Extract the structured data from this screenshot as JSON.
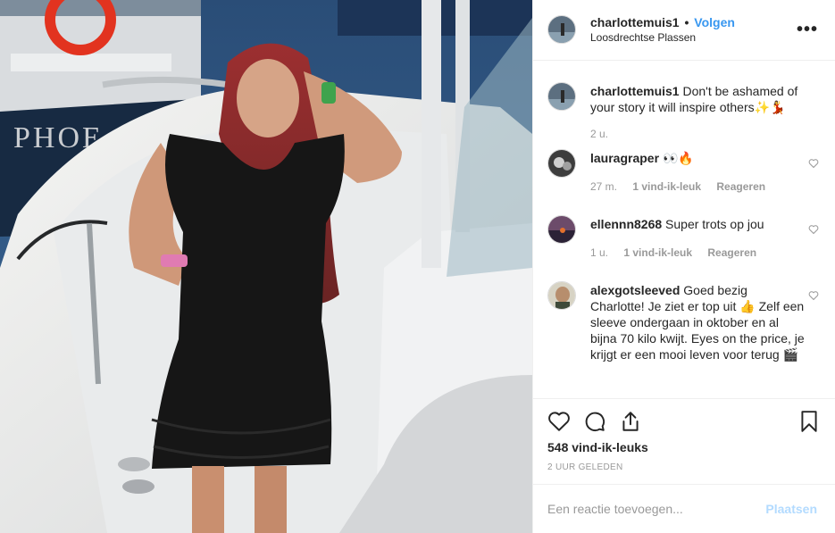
{
  "post": {
    "username": "charlottemuis1",
    "separator": "•",
    "follow_label": "Volgen",
    "location": "Loosdrechtse Plassen",
    "more_icon": "more-options-icon",
    "boat_text": "PHOE"
  },
  "caption": {
    "username": "charlottemuis1",
    "text": "Don't be ashamed of your story it will inspire others✨💃",
    "age": "2 u."
  },
  "comments": [
    {
      "username": "lauragraper",
      "text": "👀🔥",
      "age": "27 m.",
      "likes": "1 vind-ik-leuk",
      "reply": "Reageren"
    },
    {
      "username": "ellennn8268",
      "text": "Super trots op jou",
      "age": "1 u.",
      "likes": "1 vind-ik-leuk",
      "reply": "Reageren"
    },
    {
      "username": "alexgotsleeved",
      "text": "Goed bezig Charlotte! Je ziet er top uit 👍 Zelf een sleeve ondergaan in oktober en al bijna 70 kilo kwijt. Eyes on the price, je krijgt er een mooi leven voor terug 🎬"
    }
  ],
  "actions": {
    "likes_count": "548 vind-ik-leuks",
    "time_ago": "2 UUR GELEDEN"
  },
  "comment_box": {
    "placeholder": "Een reactie toevoegen...",
    "post_label": "Plaatsen"
  },
  "colors": {
    "link_blue": "#3897f0",
    "muted": "#999999",
    "post_disabled": "#b3dbff"
  }
}
